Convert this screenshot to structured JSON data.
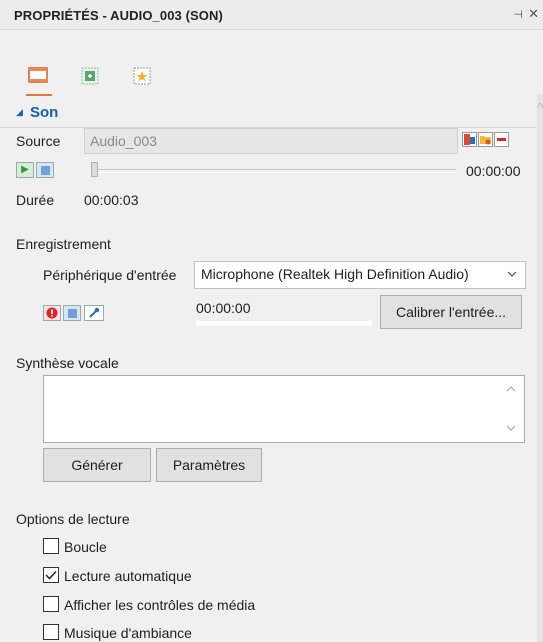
{
  "window": {
    "title": "PROPRIÉTÉS - AUDIO_003 (SON)",
    "pin_glyph": "⊣",
    "close_glyph": "✕"
  },
  "colors": {
    "accent": "#1a5fa8",
    "tab_active": "#e07a3a"
  },
  "tabs": [
    {
      "icon": "film-strip-icon"
    },
    {
      "icon": "animation-icon"
    },
    {
      "icon": "star-effect-icon"
    }
  ],
  "section": {
    "label": "Son",
    "arrow": "◢"
  },
  "source": {
    "label": "Source",
    "value": "Audio_003",
    "buttons": [
      "import-audio-icon",
      "open-folder-icon",
      "remove-icon"
    ]
  },
  "playback": {
    "time": "00:00:00",
    "play_glyph": "▶",
    "position": 0.0
  },
  "duration": {
    "label": "Durée",
    "value": "00:00:03"
  },
  "recording": {
    "heading": "Enregistrement",
    "device_label": "Périphérique d'entrée",
    "device_value": "Microphone (Realtek High Definition Audio)",
    "time": "00:00:00",
    "level": 0.0,
    "calibrate_label": "Calibrer l'entrée..."
  },
  "tts": {
    "heading": "Synthèse vocale",
    "text": "",
    "generate_label": "Générer",
    "settings_label": "Paramètres"
  },
  "options": {
    "heading": "Options de lecture",
    "items": [
      {
        "label": "Boucle",
        "checked": false
      },
      {
        "label": "Lecture automatique",
        "checked": true
      },
      {
        "label": "Afficher les contrôles de média",
        "checked": false
      },
      {
        "label": "Musique d'ambiance",
        "checked": false
      }
    ]
  }
}
